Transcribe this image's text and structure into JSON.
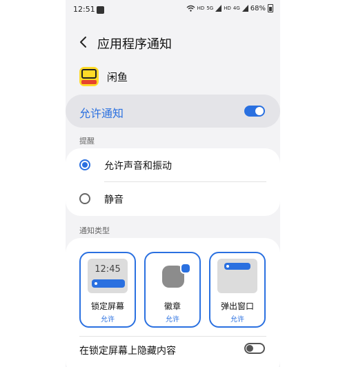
{
  "status_bar": {
    "time": "12:51",
    "network_1": "HD",
    "network_2": "5G",
    "network_3": "HD",
    "network_4": "4G",
    "battery": "68%"
  },
  "header": {
    "title": "应用程序通知"
  },
  "app": {
    "name": "闲鱼"
  },
  "allow_notifications": {
    "label": "允许通知",
    "enabled": true
  },
  "alert_section": {
    "label": "提醒",
    "options": [
      {
        "label": "允许声音和振动",
        "selected": true
      },
      {
        "label": "静音",
        "selected": false
      }
    ]
  },
  "types_section": {
    "label": "通知类型",
    "tiles": [
      {
        "label": "锁定屏幕",
        "status": "允许",
        "preview_time": "12:45"
      },
      {
        "label": "徽章",
        "status": "允许"
      },
      {
        "label": "弹出窗口",
        "status": "允许"
      }
    ],
    "hide_on_lock": {
      "label": "在锁定屏幕上隐藏内容",
      "enabled": false
    }
  },
  "colors": {
    "accent": "#2a70e0",
    "background": "#f3f3f5"
  }
}
